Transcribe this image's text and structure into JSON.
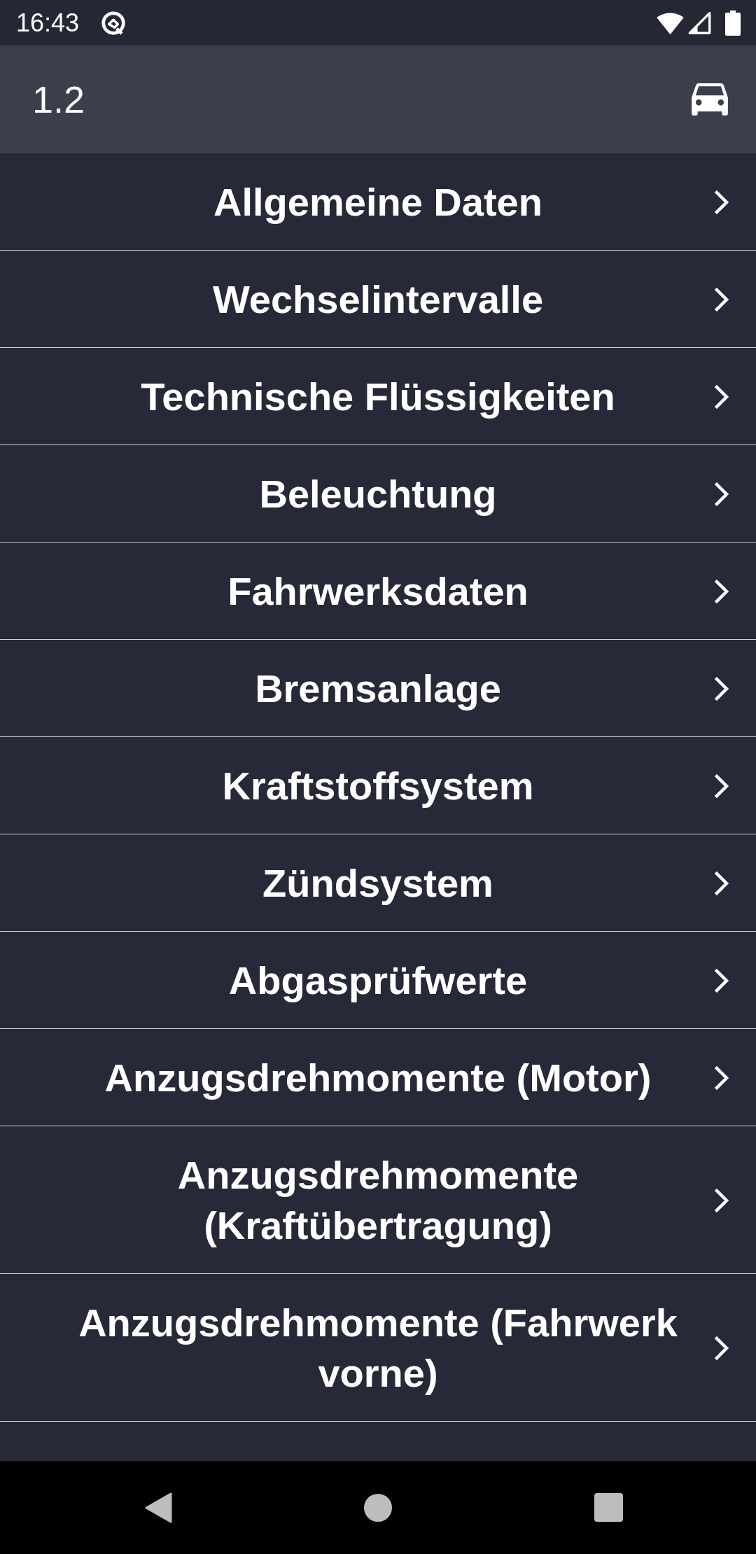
{
  "status_bar": {
    "time": "16:43"
  },
  "app_bar": {
    "title": "1.2"
  },
  "menu_items": [
    {
      "label": "Allgemeine Daten"
    },
    {
      "label": "Wechselintervalle"
    },
    {
      "label": "Technische Flüssigkeiten"
    },
    {
      "label": "Beleuchtung"
    },
    {
      "label": "Fahrwerksdaten"
    },
    {
      "label": "Bremsanlage"
    },
    {
      "label": "Kraftstoffsystem"
    },
    {
      "label": "Zündsystem"
    },
    {
      "label": "Abgasprüfwerte"
    },
    {
      "label": "Anzugsdrehmomente (Motor)"
    },
    {
      "label": "Anzugsdrehmomente (Kraftübertragung)"
    },
    {
      "label": "Anzugsdrehmomente (Fahrwerk vorne)"
    }
  ]
}
